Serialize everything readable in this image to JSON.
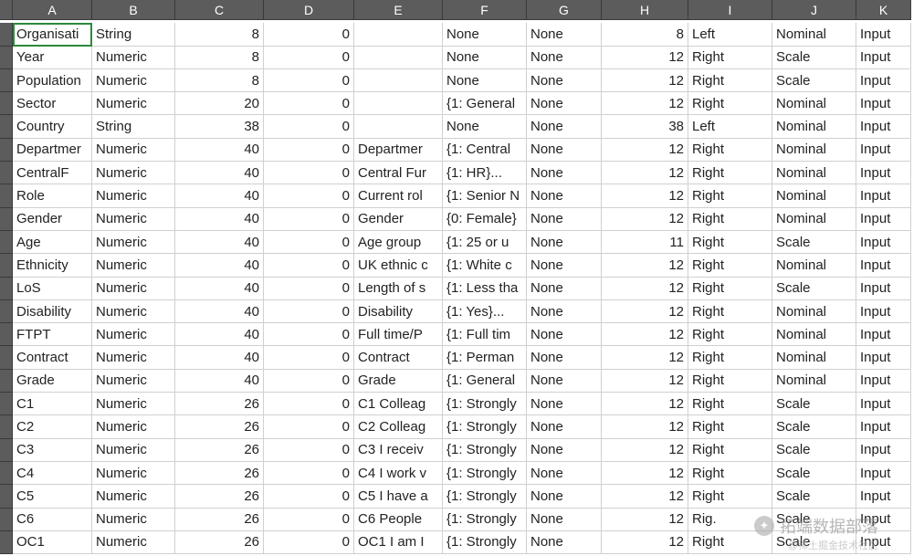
{
  "columns": [
    "A",
    "B",
    "C",
    "D",
    "E",
    "F",
    "G",
    "H",
    "I",
    "J",
    "K"
  ],
  "alignments": [
    "l",
    "l",
    "r",
    "r",
    "l",
    "l",
    "l",
    "r",
    "l",
    "l",
    "l"
  ],
  "rows": [
    {
      "A": "Organisati",
      "B": "String",
      "C": "8",
      "D": "0",
      "E": "",
      "F": "None",
      "G": "None",
      "H": "8",
      "I": "Left",
      "J": "Nominal",
      "K": "Input"
    },
    {
      "A": "Year",
      "B": "Numeric",
      "C": "8",
      "D": "0",
      "E": "",
      "F": "None",
      "G": "None",
      "H": "12",
      "I": "Right",
      "J": "Scale",
      "K": "Input"
    },
    {
      "A": "Population",
      "B": "Numeric",
      "C": "8",
      "D": "0",
      "E": "",
      "F": "None",
      "G": "None",
      "H": "12",
      "I": "Right",
      "J": "Scale",
      "K": "Input"
    },
    {
      "A": "Sector",
      "B": "Numeric",
      "C": "20",
      "D": "0",
      "E": "",
      "F": "{1: General",
      "G": "None",
      "H": "12",
      "I": "Right",
      "J": "Nominal",
      "K": "Input"
    },
    {
      "A": "Country",
      "B": "String",
      "C": "38",
      "D": "0",
      "E": "",
      "F": "None",
      "G": "None",
      "H": "38",
      "I": "Left",
      "J": "Nominal",
      "K": "Input"
    },
    {
      "A": "Departmer",
      "B": "Numeric",
      "C": "40",
      "D": "0",
      "E": "Departmer",
      "F": "{1: Central",
      "G": "None",
      "H": "12",
      "I": "Right",
      "J": "Nominal",
      "K": "Input"
    },
    {
      "A": "CentralF",
      "B": "Numeric",
      "C": "40",
      "D": "0",
      "E": "Central Fur",
      "F": "{1: HR}...",
      "G": "None",
      "H": "12",
      "I": "Right",
      "J": "Nominal",
      "K": "Input"
    },
    {
      "A": "Role",
      "B": "Numeric",
      "C": "40",
      "D": "0",
      "E": "Current rol",
      "F": "{1: Senior N",
      "G": "None",
      "H": "12",
      "I": "Right",
      "J": "Nominal",
      "K": "Input"
    },
    {
      "A": "Gender",
      "B": "Numeric",
      "C": "40",
      "D": "0",
      "E": "Gender",
      "F": "{0: Female}",
      "G": "None",
      "H": "12",
      "I": "Right",
      "J": "Nominal",
      "K": "Input"
    },
    {
      "A": "Age",
      "B": "Numeric",
      "C": "40",
      "D": "0",
      "E": "Age group",
      "F": "{1: 25 or u",
      "G": "None",
      "H": "11",
      "I": "Right",
      "J": "Scale",
      "K": "Input"
    },
    {
      "A": "Ethnicity",
      "B": "Numeric",
      "C": "40",
      "D": "0",
      "E": "UK ethnic c",
      "F": "{1: White c",
      "G": "None",
      "H": "12",
      "I": "Right",
      "J": "Nominal",
      "K": "Input"
    },
    {
      "A": "LoS",
      "B": "Numeric",
      "C": "40",
      "D": "0",
      "E": "Length of s",
      "F": "{1: Less tha",
      "G": "None",
      "H": "12",
      "I": "Right",
      "J": "Scale",
      "K": "Input"
    },
    {
      "A": "Disability",
      "B": "Numeric",
      "C": "40",
      "D": "0",
      "E": "Disability",
      "F": "{1: Yes}...",
      "G": "None",
      "H": "12",
      "I": "Right",
      "J": "Nominal",
      "K": "Input"
    },
    {
      "A": "FTPT",
      "B": "Numeric",
      "C": "40",
      "D": "0",
      "E": "Full time/P",
      "F": "{1: Full tim",
      "G": "None",
      "H": "12",
      "I": "Right",
      "J": "Nominal",
      "K": "Input"
    },
    {
      "A": "Contract",
      "B": "Numeric",
      "C": "40",
      "D": "0",
      "E": "Contract",
      "F": "{1: Perman",
      "G": "None",
      "H": "12",
      "I": "Right",
      "J": "Nominal",
      "K": "Input"
    },
    {
      "A": "Grade",
      "B": "Numeric",
      "C": "40",
      "D": "0",
      "E": "Grade",
      "F": "{1: General",
      "G": "None",
      "H": "12",
      "I": "Right",
      "J": "Nominal",
      "K": "Input"
    },
    {
      "A": "C1",
      "B": "Numeric",
      "C": "26",
      "D": "0",
      "E": "C1 Colleag",
      "F": "{1: Strongly",
      "G": "None",
      "H": "12",
      "I": "Right",
      "J": "Scale",
      "K": "Input"
    },
    {
      "A": "C2",
      "B": "Numeric",
      "C": "26",
      "D": "0",
      "E": "C2 Colleag",
      "F": "{1: Strongly",
      "G": "None",
      "H": "12",
      "I": "Right",
      "J": "Scale",
      "K": "Input"
    },
    {
      "A": "C3",
      "B": "Numeric",
      "C": "26",
      "D": "0",
      "E": "C3 I receiv",
      "F": "{1: Strongly",
      "G": "None",
      "H": "12",
      "I": "Right",
      "J": "Scale",
      "K": "Input"
    },
    {
      "A": "C4",
      "B": "Numeric",
      "C": "26",
      "D": "0",
      "E": "C4 I work v",
      "F": "{1: Strongly",
      "G": "None",
      "H": "12",
      "I": "Right",
      "J": "Scale",
      "K": "Input"
    },
    {
      "A": "C5",
      "B": "Numeric",
      "C": "26",
      "D": "0",
      "E": "C5 I have a",
      "F": "{1: Strongly",
      "G": "None",
      "H": "12",
      "I": "Right",
      "J": "Scale",
      "K": "Input"
    },
    {
      "A": "C6",
      "B": "Numeric",
      "C": "26",
      "D": "0",
      "E": "C6 People",
      "F": "{1: Strongly",
      "G": "None",
      "H": "12",
      "I": "Rig.",
      "J": "Scale",
      "K": "Input"
    },
    {
      "A": "OC1",
      "B": "Numeric",
      "C": "26",
      "D": "0",
      "E": "OC1 I am I",
      "F": "{1: Strongly",
      "G": "None",
      "H": "12",
      "I": "Right",
      "J": "Scale",
      "K": "Input"
    }
  ],
  "watermark": {
    "main": "拓端数据部落",
    "sub": "@稀土掘金技术社区"
  }
}
